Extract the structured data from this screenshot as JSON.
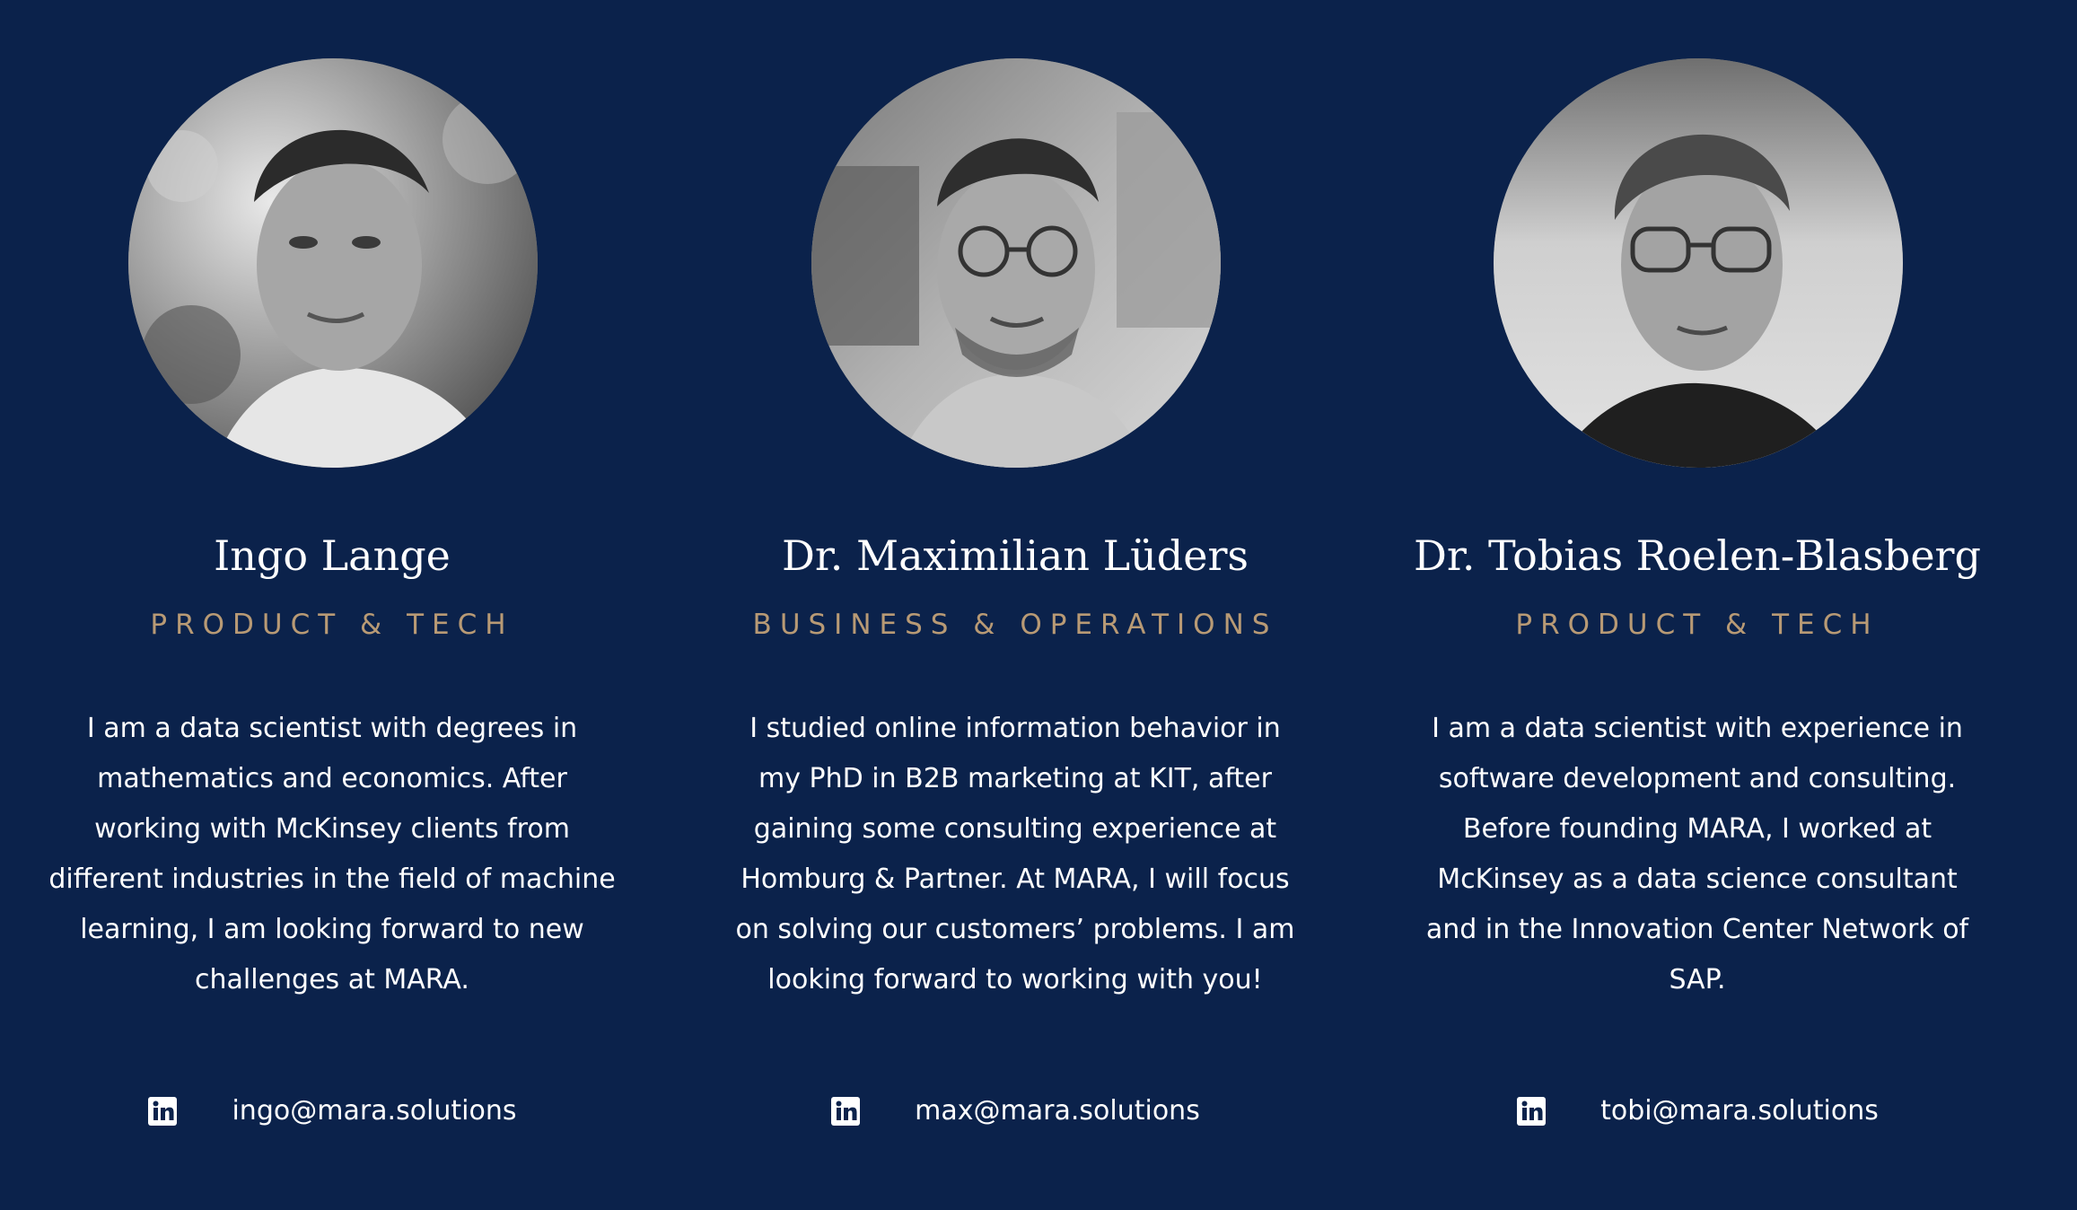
{
  "team": [
    {
      "name": "Ingo Lange",
      "role": "PRODUCT & TECH",
      "bio": "I am a data scientist with degrees in mathematics and economics. After working with McKinsey clients from different industries in the field of machine learning, I am looking forward to new challenges at MARA.",
      "email": "ingo@mara.solutions",
      "social_icon": "linkedin-icon"
    },
    {
      "name": "Dr. Maximilian Lüders",
      "role": "BUSINESS & OPERATIONS",
      "bio": "I studied online information behavior in my PhD in B2B marketing at KIT, after gaining some consulting experience at Homburg & Partner. At MARA, I will focus on solving our customers’ problems. I am looking forward to working with you!",
      "email": "max@mara.solutions",
      "social_icon": "linkedin-icon"
    },
    {
      "name": "Dr. Tobias Roelen-Blasberg",
      "role": "PRODUCT & TECH",
      "bio": "I am a data scientist with experience in software development and consulting. Before founding MARA, I worked at McKinsey as a data science consultant and in the Innovation Center Network of SAP.",
      "email": "tobi@mara.solutions",
      "social_icon": "linkedin-icon"
    }
  ],
  "colors": {
    "background": "#0b224b",
    "accent": "#b89a75",
    "text": "#ffffff"
  }
}
